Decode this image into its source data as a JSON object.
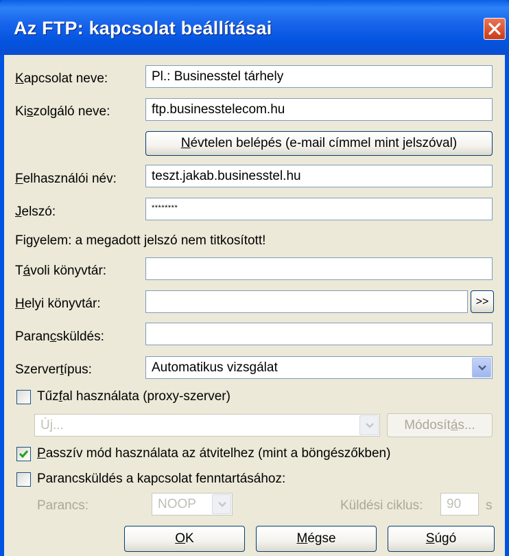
{
  "window": {
    "title": "Az FTP: kapcsolat beállításai"
  },
  "fields": {
    "connection_name": {
      "label_pre": "",
      "label_key": "K",
      "label_post": "apcsolat neve:",
      "value": "Pl.: Businesstel tárhely"
    },
    "server_name": {
      "label_pre": "Ki",
      "label_key": "s",
      "label_post": "zolgáló neve:",
      "value": "ftp.businesstelecom.hu"
    },
    "anonymous_button": {
      "label_pre": "",
      "label_key": "N",
      "label_post": "évtelen belépés (e-mail címmel mint jelszóval)"
    },
    "username": {
      "label_pre": "",
      "label_key": "F",
      "label_post": "elhasználói név:",
      "value": "teszt.jakab.businesstel.hu"
    },
    "password": {
      "label_pre": "",
      "label_key": "J",
      "label_post": "elszó:",
      "value": "********"
    },
    "warning": "Figyelem: a megadott jelszó nem titkosított!",
    "remote_dir": {
      "label_pre": "T",
      "label_key": "á",
      "label_post": "voli könyvtár:",
      "value": ""
    },
    "local_dir": {
      "label_pre": "",
      "label_key": "H",
      "label_post": "elyi könyvtár:",
      "value": "",
      "browse_label": ">>"
    },
    "command": {
      "label_pre": "Paran",
      "label_key": "c",
      "label_post": "sküldés:",
      "value": ""
    },
    "server_type": {
      "label_pre": "Szerver",
      "label_key": "t",
      "label_post": "ípus:",
      "value": "Automatikus vizsgálat"
    }
  },
  "firewall": {
    "checked": false,
    "label_pre": "Tűz",
    "label_key": "f",
    "label_post": "al használata (proxy-szerver)",
    "select_value": "Új...",
    "modify_pre": "Módosít",
    "modify_key": "á",
    "modify_post": "s..."
  },
  "passive": {
    "checked": true,
    "label_pre": "",
    "label_key": "P",
    "label_post": "asszív mód használata az átvitelhez (mint a böngészőkben)"
  },
  "keepalive": {
    "checked": false,
    "label": "Parancsküldés a kapcsolat fenntartásához:",
    "command_label": "Parancs:",
    "command_value": "NOOP",
    "cycle_label": "Küldési ciklus:",
    "cycle_value": "90",
    "cycle_unit": "s"
  },
  "buttons": {
    "ok_key": "O",
    "ok_post": "K",
    "cancel_pre": "",
    "cancel_key": "M",
    "cancel_post": "égse",
    "help_pre": "",
    "help_key": "S",
    "help_post": "úgó"
  },
  "colors": {
    "titlebar": "#0054e3",
    "dialog_bg": "#ece9d8",
    "checkmark": "#21a121",
    "close_red": "#e0542d"
  }
}
